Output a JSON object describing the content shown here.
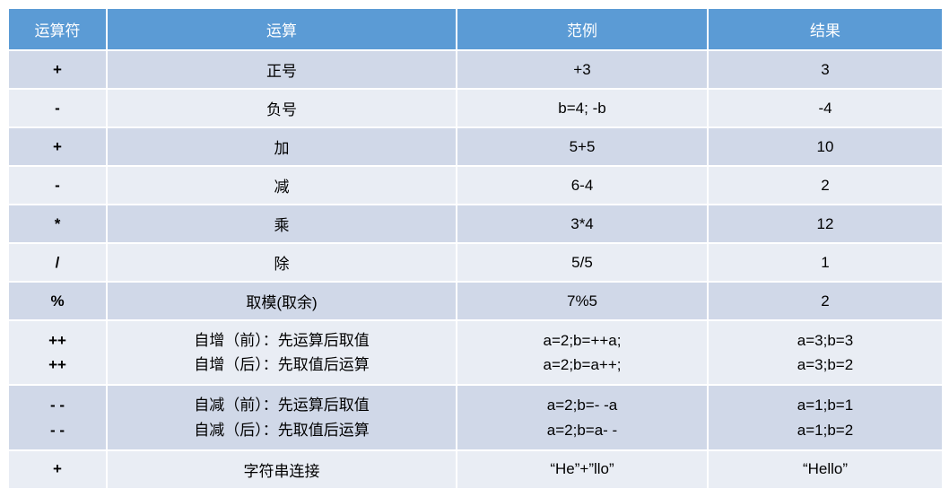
{
  "headers": {
    "operator": "运算符",
    "operation": "运算",
    "example": "范例",
    "result": "结果"
  },
  "rows": [
    {
      "operator": "+",
      "operation": "正号",
      "example": "+3",
      "result": "3"
    },
    {
      "operator": "-",
      "operation": "负号",
      "example": "b=4; -b",
      "result": "-4"
    },
    {
      "operator": "+",
      "operation": "加",
      "example": "5+5",
      "result": "10"
    },
    {
      "operator": "-",
      "operation": "减",
      "example": "6-4",
      "result": "2"
    },
    {
      "operator": "*",
      "operation": "乘",
      "example": "3*4",
      "result": "12"
    },
    {
      "operator": "/",
      "operation": "除",
      "example": "5/5",
      "result": "1"
    },
    {
      "operator": "%",
      "operation": "取模(取余)",
      "example": "7%5",
      "result": "2"
    },
    {
      "operator_lines": [
        "++",
        "++"
      ],
      "operation_lines": [
        "自增（前）：先运算后取值",
        "自增（后）：先取值后运算"
      ],
      "example_lines": [
        "a=2;b=++a;",
        "a=2;b=a++;"
      ],
      "result_lines": [
        "a=3;b=3",
        "a=3;b=2"
      ]
    },
    {
      "operator_lines": [
        "- -",
        "- -"
      ],
      "operation_lines": [
        "自减（前）：先运算后取值",
        "自减（后）：先取值后运算"
      ],
      "example_lines": [
        "a=2;b=- -a",
        "a=2;b=a- -"
      ],
      "result_lines": [
        "a=1;b=1",
        "a=1;b=2"
      ]
    },
    {
      "operator": "+",
      "operation": "字符串连接",
      "example": "“He”+”llo”",
      "result": "“Hello”"
    }
  ]
}
